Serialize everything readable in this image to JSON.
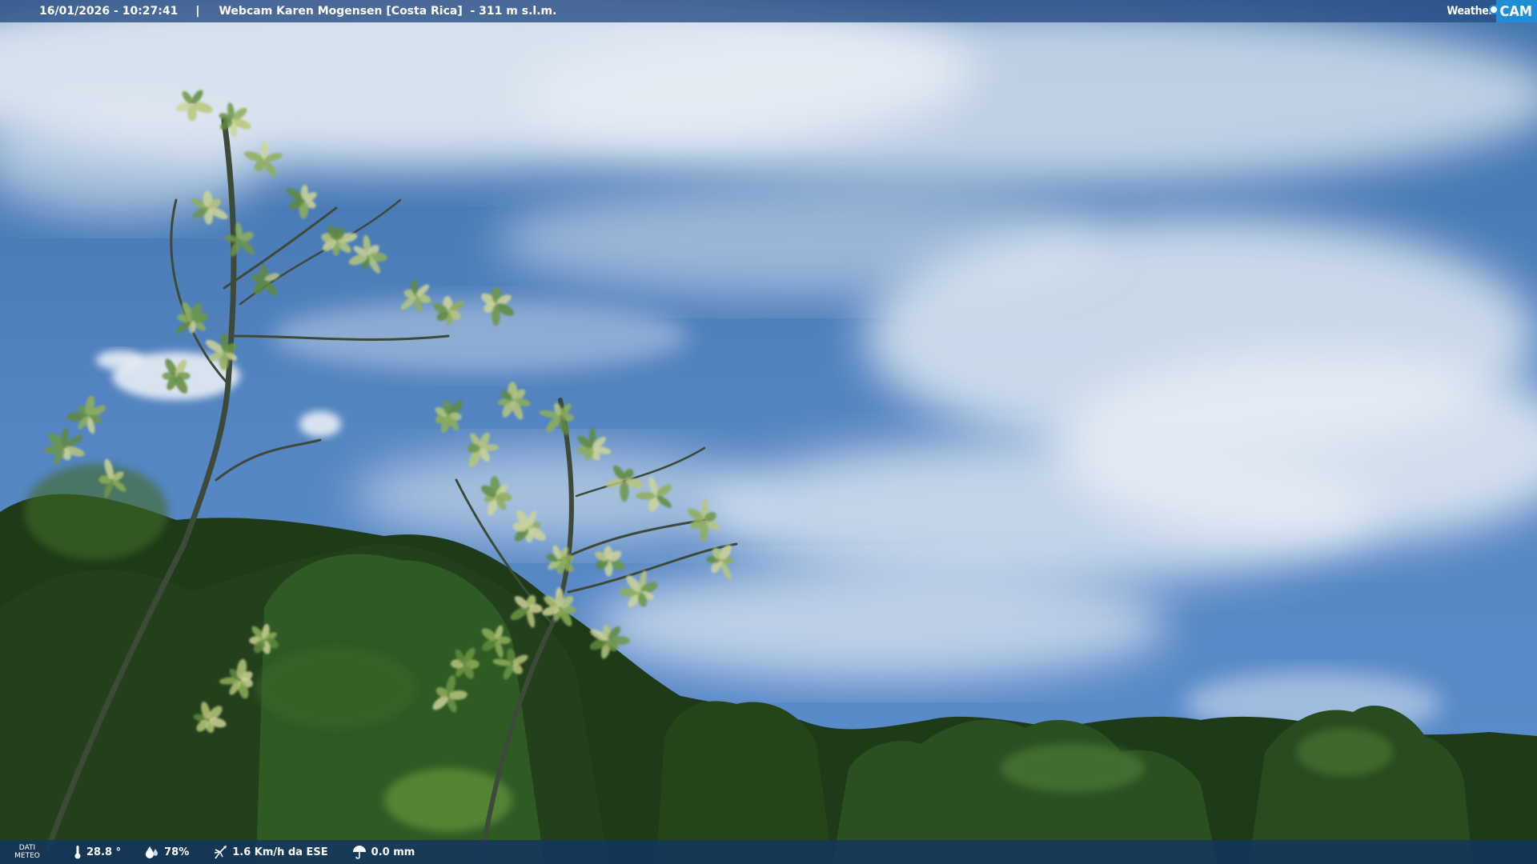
{
  "header": {
    "datetime": "16/01/2026 - 10:27:41",
    "separator": "|",
    "title": "Webcam Karen Mogensen [Costa Rica]  - 311 m s.l.m."
  },
  "logo": {
    "part1": "Weather",
    "part2": "CAM"
  },
  "weather_bar": {
    "label_line1": "DATI",
    "label_line2": "METEO",
    "temperature": "28.8 °",
    "humidity": "78%",
    "wind": "1.6 Km/h da ESE",
    "rain": "0.0 mm",
    "icons": [
      "thermometer-icon",
      "humidity-drop-icon",
      "wind-icon",
      "rain-gauge-icon"
    ]
  },
  "colors": {
    "sky_top": "#3f72ad",
    "sky_bottom": "#5b8ccc",
    "cloud": "#e8eef5",
    "foliage_dark": "#1e3a18",
    "foliage_mid": "#3b6a2a",
    "foliage_light": "#b7c77a",
    "bar_bg": "#1a3f70",
    "logo_accent": "#1e8fd6"
  }
}
